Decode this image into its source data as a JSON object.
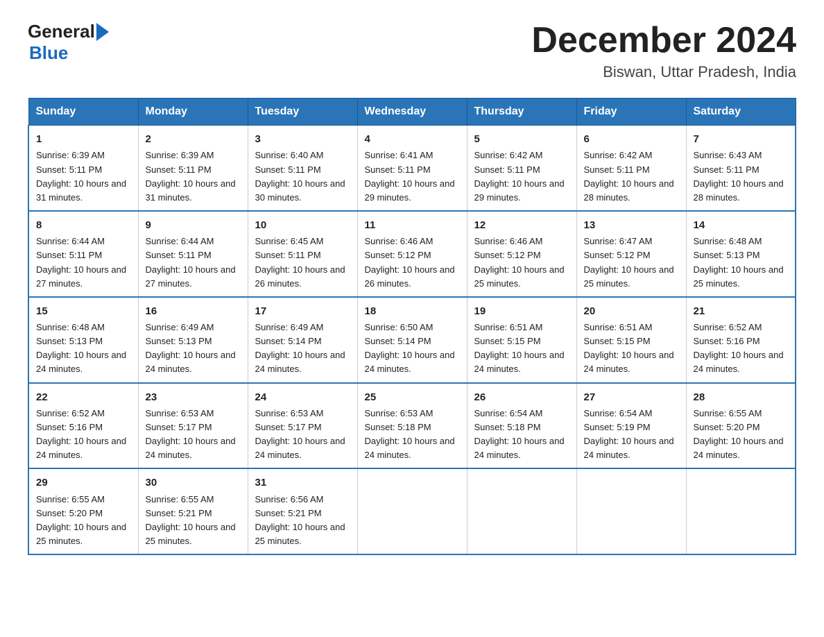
{
  "header": {
    "logo_general": "General",
    "logo_blue": "Blue",
    "month_title": "December 2024",
    "location": "Biswan, Uttar Pradesh, India"
  },
  "calendar": {
    "days_of_week": [
      "Sunday",
      "Monday",
      "Tuesday",
      "Wednesday",
      "Thursday",
      "Friday",
      "Saturday"
    ],
    "weeks": [
      [
        {
          "day": "1",
          "sunrise": "6:39 AM",
          "sunset": "5:11 PM",
          "daylight": "10 hours and 31 minutes."
        },
        {
          "day": "2",
          "sunrise": "6:39 AM",
          "sunset": "5:11 PM",
          "daylight": "10 hours and 31 minutes."
        },
        {
          "day": "3",
          "sunrise": "6:40 AM",
          "sunset": "5:11 PM",
          "daylight": "10 hours and 30 minutes."
        },
        {
          "day": "4",
          "sunrise": "6:41 AM",
          "sunset": "5:11 PM",
          "daylight": "10 hours and 29 minutes."
        },
        {
          "day": "5",
          "sunrise": "6:42 AM",
          "sunset": "5:11 PM",
          "daylight": "10 hours and 29 minutes."
        },
        {
          "day": "6",
          "sunrise": "6:42 AM",
          "sunset": "5:11 PM",
          "daylight": "10 hours and 28 minutes."
        },
        {
          "day": "7",
          "sunrise": "6:43 AM",
          "sunset": "5:11 PM",
          "daylight": "10 hours and 28 minutes."
        }
      ],
      [
        {
          "day": "8",
          "sunrise": "6:44 AM",
          "sunset": "5:11 PM",
          "daylight": "10 hours and 27 minutes."
        },
        {
          "day": "9",
          "sunrise": "6:44 AM",
          "sunset": "5:11 PM",
          "daylight": "10 hours and 27 minutes."
        },
        {
          "day": "10",
          "sunrise": "6:45 AM",
          "sunset": "5:11 PM",
          "daylight": "10 hours and 26 minutes."
        },
        {
          "day": "11",
          "sunrise": "6:46 AM",
          "sunset": "5:12 PM",
          "daylight": "10 hours and 26 minutes."
        },
        {
          "day": "12",
          "sunrise": "6:46 AM",
          "sunset": "5:12 PM",
          "daylight": "10 hours and 25 minutes."
        },
        {
          "day": "13",
          "sunrise": "6:47 AM",
          "sunset": "5:12 PM",
          "daylight": "10 hours and 25 minutes."
        },
        {
          "day": "14",
          "sunrise": "6:48 AM",
          "sunset": "5:13 PM",
          "daylight": "10 hours and 25 minutes."
        }
      ],
      [
        {
          "day": "15",
          "sunrise": "6:48 AM",
          "sunset": "5:13 PM",
          "daylight": "10 hours and 24 minutes."
        },
        {
          "day": "16",
          "sunrise": "6:49 AM",
          "sunset": "5:13 PM",
          "daylight": "10 hours and 24 minutes."
        },
        {
          "day": "17",
          "sunrise": "6:49 AM",
          "sunset": "5:14 PM",
          "daylight": "10 hours and 24 minutes."
        },
        {
          "day": "18",
          "sunrise": "6:50 AM",
          "sunset": "5:14 PM",
          "daylight": "10 hours and 24 minutes."
        },
        {
          "day": "19",
          "sunrise": "6:51 AM",
          "sunset": "5:15 PM",
          "daylight": "10 hours and 24 minutes."
        },
        {
          "day": "20",
          "sunrise": "6:51 AM",
          "sunset": "5:15 PM",
          "daylight": "10 hours and 24 minutes."
        },
        {
          "day": "21",
          "sunrise": "6:52 AM",
          "sunset": "5:16 PM",
          "daylight": "10 hours and 24 minutes."
        }
      ],
      [
        {
          "day": "22",
          "sunrise": "6:52 AM",
          "sunset": "5:16 PM",
          "daylight": "10 hours and 24 minutes."
        },
        {
          "day": "23",
          "sunrise": "6:53 AM",
          "sunset": "5:17 PM",
          "daylight": "10 hours and 24 minutes."
        },
        {
          "day": "24",
          "sunrise": "6:53 AM",
          "sunset": "5:17 PM",
          "daylight": "10 hours and 24 minutes."
        },
        {
          "day": "25",
          "sunrise": "6:53 AM",
          "sunset": "5:18 PM",
          "daylight": "10 hours and 24 minutes."
        },
        {
          "day": "26",
          "sunrise": "6:54 AM",
          "sunset": "5:18 PM",
          "daylight": "10 hours and 24 minutes."
        },
        {
          "day": "27",
          "sunrise": "6:54 AM",
          "sunset": "5:19 PM",
          "daylight": "10 hours and 24 minutes."
        },
        {
          "day": "28",
          "sunrise": "6:55 AM",
          "sunset": "5:20 PM",
          "daylight": "10 hours and 24 minutes."
        }
      ],
      [
        {
          "day": "29",
          "sunrise": "6:55 AM",
          "sunset": "5:20 PM",
          "daylight": "10 hours and 25 minutes."
        },
        {
          "day": "30",
          "sunrise": "6:55 AM",
          "sunset": "5:21 PM",
          "daylight": "10 hours and 25 minutes."
        },
        {
          "day": "31",
          "sunrise": "6:56 AM",
          "sunset": "5:21 PM",
          "daylight": "10 hours and 25 minutes."
        },
        null,
        null,
        null,
        null
      ]
    ]
  }
}
